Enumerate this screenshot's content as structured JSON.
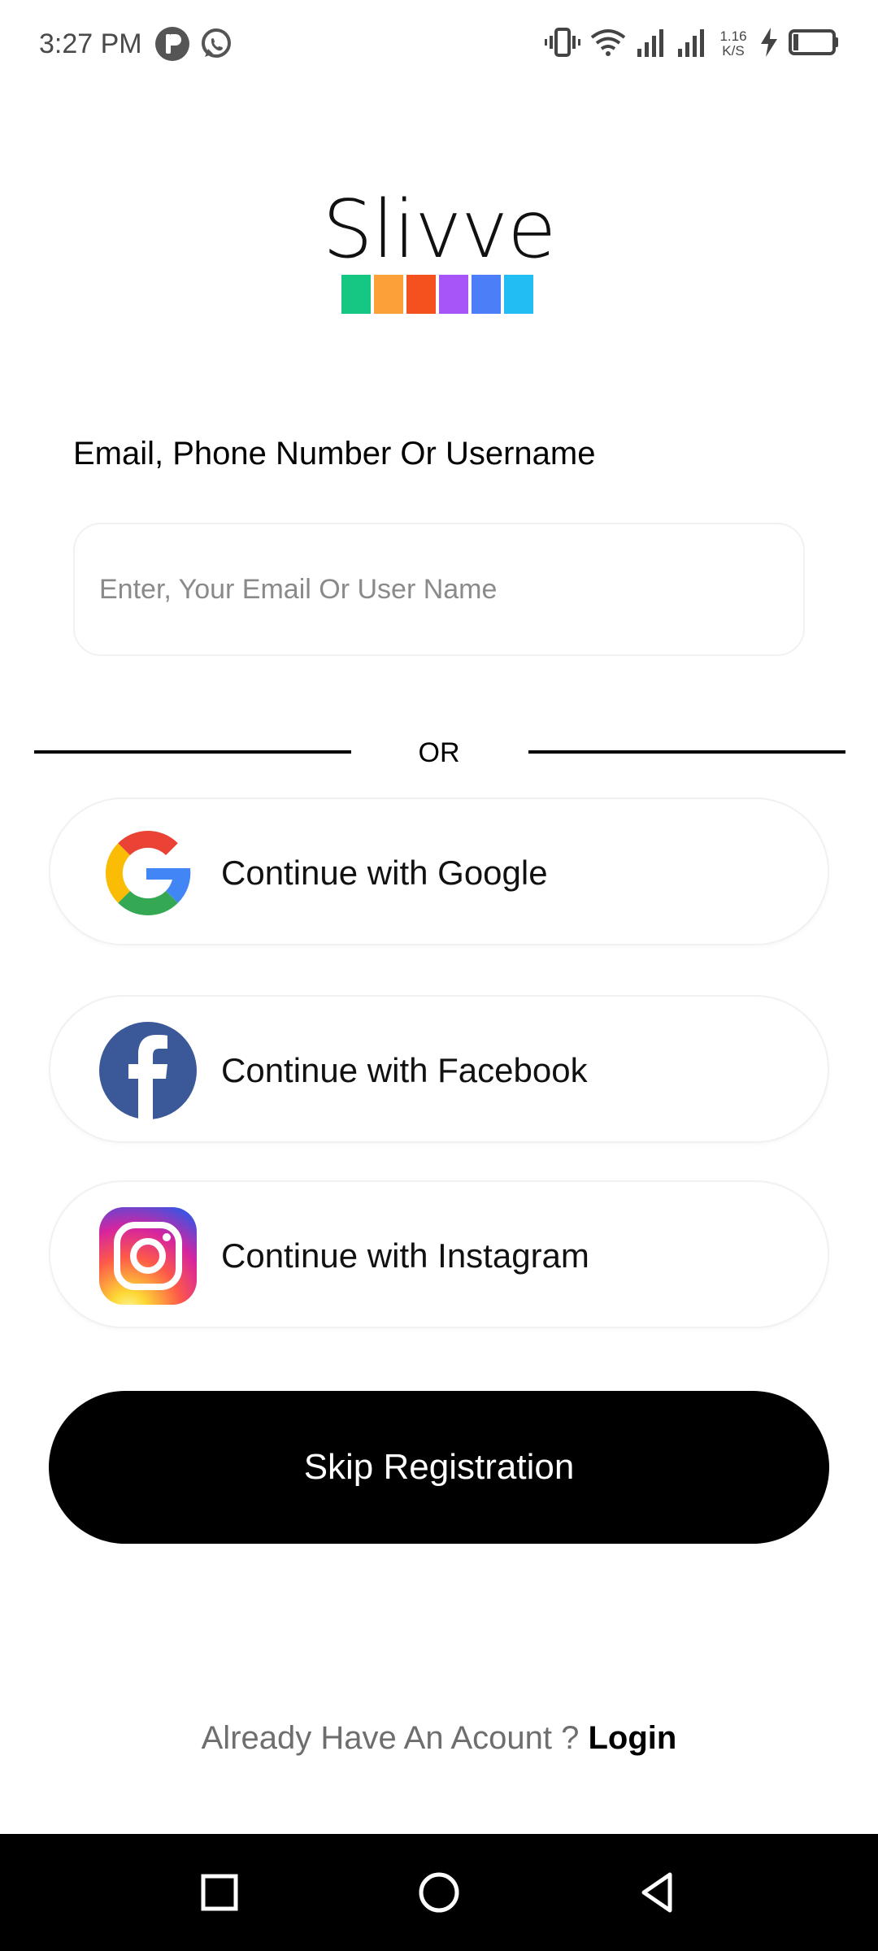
{
  "status_bar": {
    "time": "3:27 PM",
    "net_speed_value": "1.16",
    "net_speed_unit": "K/S",
    "icons": [
      "app-p-icon",
      "whatsapp-icon",
      "vibrate-icon",
      "wifi-icon",
      "signal-icon",
      "signal-icon",
      "charging-icon",
      "battery-icon"
    ]
  },
  "logo": {
    "wordmark": "Slivve",
    "colors": [
      "#16c784",
      "#fca138",
      "#f4511e",
      "#a855f7",
      "#4c7ff7",
      "#22bdf2"
    ]
  },
  "form": {
    "field_label": "Email, Phone Number Or Username",
    "input_placeholder": "Enter, Your Email Or User Name",
    "input_value": ""
  },
  "divider": {
    "text": "OR"
  },
  "social": {
    "google_label": "Continue with Google",
    "facebook_label": "Continue with Facebook",
    "instagram_label": "Continue with Instagram"
  },
  "skip": {
    "label": "Skip Registration"
  },
  "footer": {
    "prompt": "Already Have An Acount ?",
    "login_label": "Login"
  },
  "nav": {
    "icons": [
      "recents-icon",
      "home-icon",
      "back-icon"
    ]
  }
}
